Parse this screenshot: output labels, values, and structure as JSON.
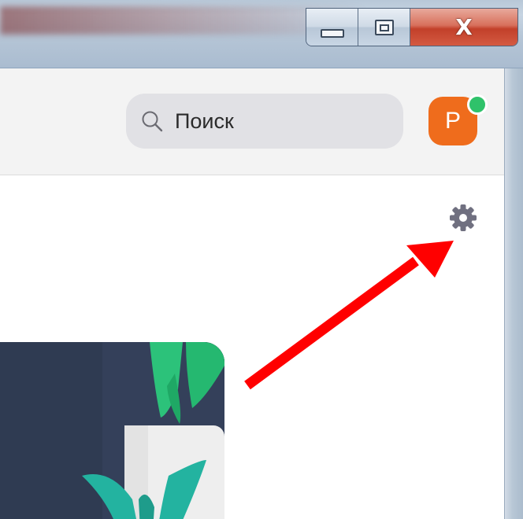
{
  "search": {
    "label": "Поиск"
  },
  "user": {
    "avatar_initial": "P",
    "status_color": "#2fc26a",
    "avatar_color": "#ef6c1c"
  },
  "window_controls": [
    "minimize",
    "maximize",
    "close"
  ],
  "icons": {
    "search": "search-icon",
    "settings": "gear-icon",
    "annotation": "red-arrow"
  },
  "colors": {
    "arrow": "#ff0000",
    "gear": "#707080",
    "header_bg": "#f3f3f3"
  }
}
